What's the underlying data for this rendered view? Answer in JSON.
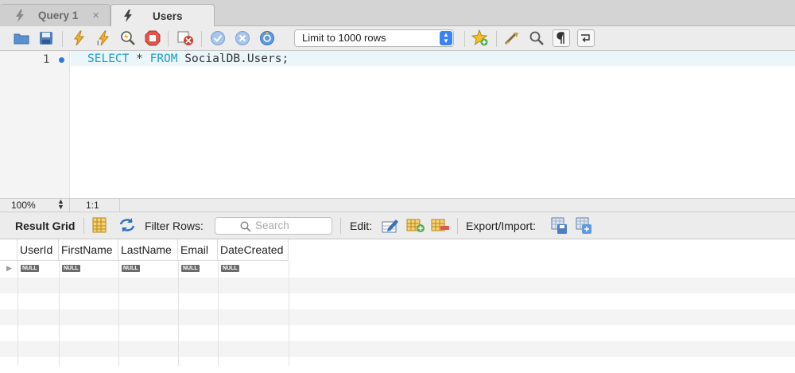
{
  "tabs": [
    {
      "label": "Query 1",
      "close": "×"
    },
    {
      "label": "Users"
    }
  ],
  "toolbar": {
    "limit_select": "Limit to 1000 rows"
  },
  "editor": {
    "line_number": "1",
    "sql_keyword_1": "SELECT",
    "sql_star": " * ",
    "sql_keyword_2": "FROM",
    "sql_rest": " SocialDB.Users;"
  },
  "status": {
    "zoom": "100%",
    "cursor_position": "1:1"
  },
  "result_bar": {
    "result_grid_label": "Result Grid",
    "filter_rows_label": "Filter Rows:",
    "search_placeholder": "Search",
    "edit_label": "Edit:",
    "export_import_label": "Export/Import:"
  },
  "grid": {
    "columns": [
      "UserId",
      "FirstName",
      "LastName",
      "Email",
      "DateCreated"
    ],
    "row": [
      "NULL",
      "NULL",
      "NULL",
      "NULL",
      "NULL"
    ]
  },
  "colors": {
    "keyword": "#1a9dc4",
    "accent": "#3b82f6"
  }
}
